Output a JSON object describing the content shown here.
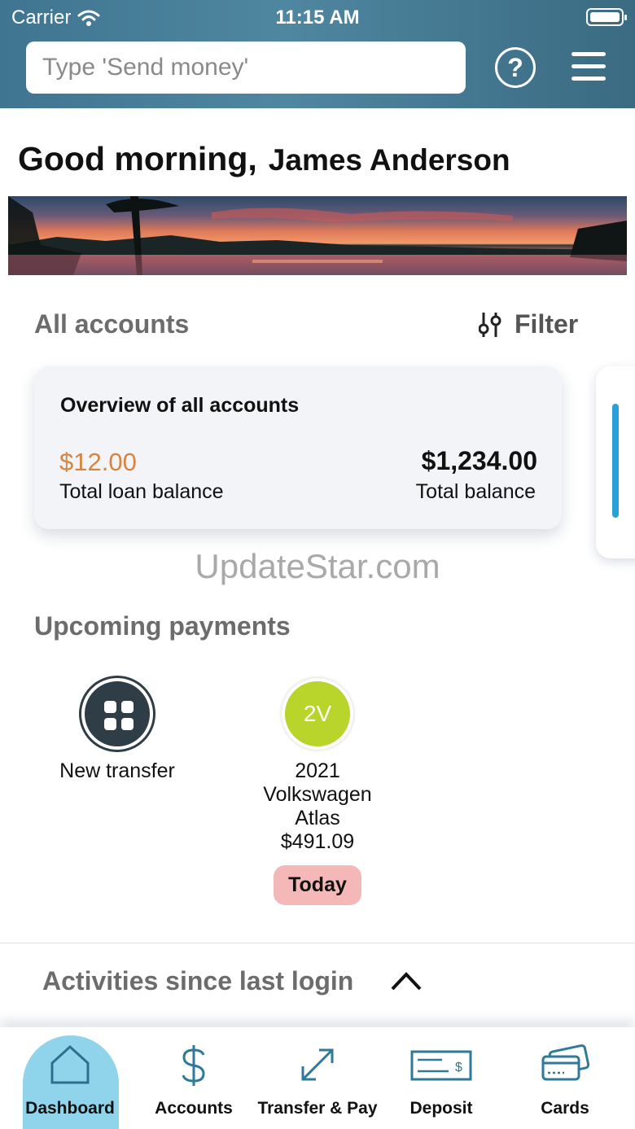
{
  "status_bar": {
    "carrier": "Carrier",
    "time": "11:15 AM"
  },
  "header": {
    "search_placeholder": "Type 'Send money'",
    "help_icon": "question-circle-icon",
    "menu_icon": "hamburger-menu-icon"
  },
  "greeting": {
    "salutation": "Good morning,",
    "name": "James Anderson"
  },
  "accounts": {
    "title": "All accounts",
    "filter_label": "Filter",
    "overview_card": {
      "title": "Overview of all accounts",
      "loan_amount": "$12.00",
      "loan_label": "Total loan balance",
      "balance_amount": "$1,234.00",
      "balance_label": "Total balance"
    }
  },
  "watermark": "UpdateStar.com",
  "upcoming": {
    "title": "Upcoming payments",
    "items": [
      {
        "label": "New transfer"
      },
      {
        "initials": "2V",
        "line1": "2021",
        "line2": "Volkswagen",
        "line3": "Atlas",
        "amount": "$491.09",
        "badge": "Today"
      }
    ]
  },
  "activities": {
    "title": "Activities since last login"
  },
  "tabs": [
    {
      "label": "Dashboard",
      "icon": "home-icon",
      "active": true
    },
    {
      "label": "Accounts",
      "icon": "dollar-icon"
    },
    {
      "label": "Transfer & Pay",
      "icon": "transfer-arrows-icon"
    },
    {
      "label": "Deposit",
      "icon": "check-deposit-icon"
    },
    {
      "label": "Cards",
      "icon": "credit-cards-icon"
    }
  ],
  "colors": {
    "header": "#4a7f99",
    "loan": "#d9843e",
    "accent": "#2a9fd8",
    "today_badge": "#f5b8b8",
    "avatar_green": "#b9d42a",
    "tab_active": "#8fd4ea",
    "icon_blue": "#2e7a9a"
  }
}
